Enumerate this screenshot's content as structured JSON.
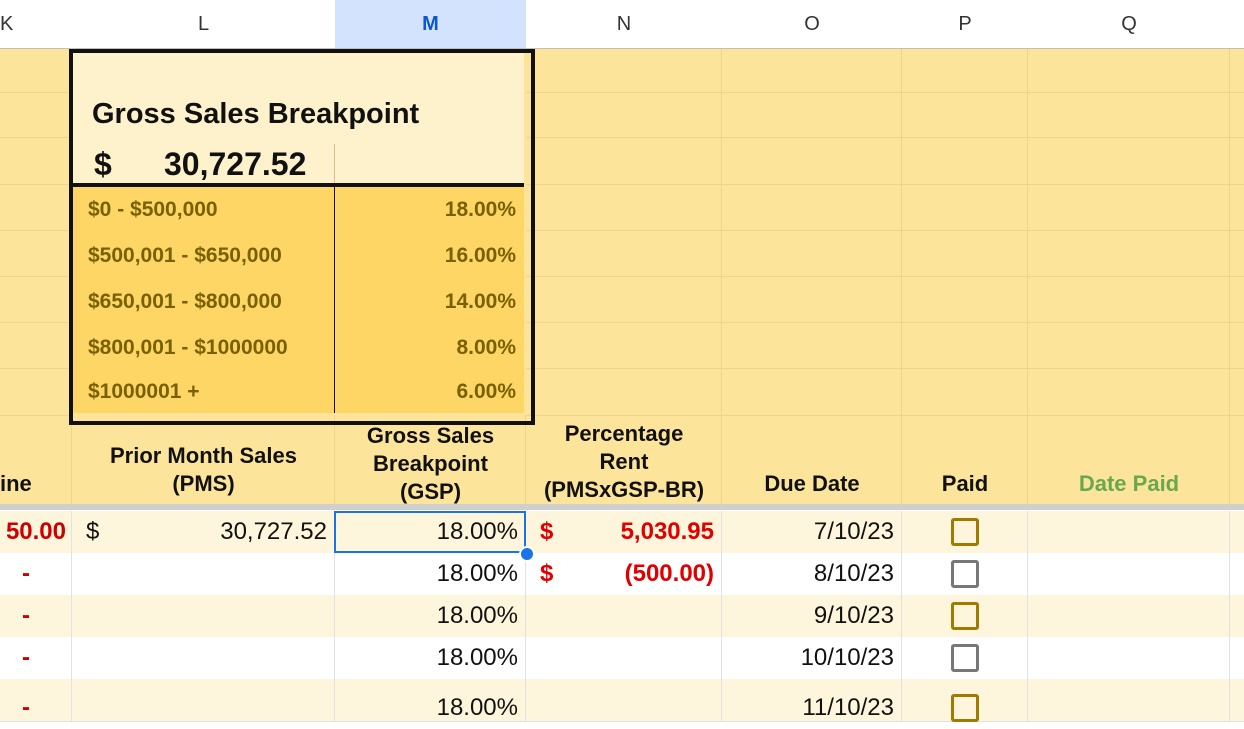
{
  "columns": [
    "K",
    "L",
    "M",
    "N",
    "O",
    "P",
    "Q"
  ],
  "breakpoint": {
    "title": "Gross Sales Breakpoint",
    "currency": "$",
    "value": "30,727.52",
    "tiers": [
      {
        "range": "$0 - $500,000",
        "pct": "18.00%"
      },
      {
        "range": "$500,001 - $650,000",
        "pct": "16.00%"
      },
      {
        "range": "$650,001 - $800,000",
        "pct": "14.00%"
      },
      {
        "range": "$800,001 - $1000000",
        "pct": "8.00%"
      },
      {
        "range": "$1000001 +",
        "pct": "6.00%"
      }
    ]
  },
  "headers": {
    "k": "ine",
    "l_line1": "Prior Month Sales",
    "l_line2": "(PMS)",
    "m_line1": "Gross Sales",
    "m_line2": "Breakpoint",
    "m_line3": "(GSP)",
    "n_line1": "Percentage",
    "n_line2": "Rent",
    "n_line3": "(PMSxGSP-BR)",
    "o": "Due Date",
    "p": "Paid",
    "q": "Date Paid"
  },
  "rows": [
    {
      "k": "50.00",
      "l_cur": "$",
      "l_val": "30,727.52",
      "m": "18.00%",
      "n_cur": "$",
      "n_val": "5,030.95",
      "o": "7/10/23"
    },
    {
      "k": "-",
      "l_cur": "",
      "l_val": "",
      "m": "18.00%",
      "n_cur": "$",
      "n_val": "(500.00)",
      "o": "8/10/23"
    },
    {
      "k": "-",
      "l_cur": "",
      "l_val": "",
      "m": "18.00%",
      "n_cur": "",
      "n_val": "",
      "o": "9/10/23"
    },
    {
      "k": "-",
      "l_cur": "",
      "l_val": "",
      "m": "18.00%",
      "n_cur": "",
      "n_val": "",
      "o": "10/10/23"
    },
    {
      "k": "-",
      "l_cur": "",
      "l_val": "",
      "m": "18.00%",
      "n_cur": "",
      "n_val": "",
      "o": "11/10/23"
    }
  ],
  "colors": {
    "accent": "#1a73e8",
    "header_fill": "#fde49b",
    "tier_fill": "#fdd665",
    "red": "#e00000"
  }
}
